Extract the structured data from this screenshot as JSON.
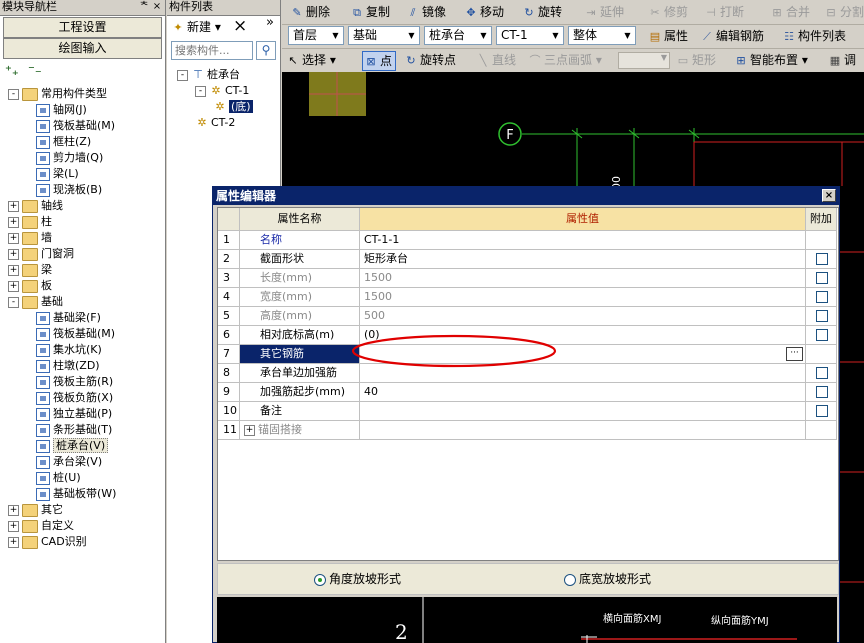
{
  "nav": {
    "title": "模块导航栏",
    "pin": "ᅕ",
    "close": "×",
    "btn_settings": "工程设置",
    "btn_drawing": "绘图输入",
    "tree": [
      {
        "label": "常用构件类型",
        "indent": 0,
        "type": "folder",
        "expand": "-"
      },
      {
        "label": "轴网(J)",
        "indent": 1,
        "type": "comp"
      },
      {
        "label": "筏板基础(M)",
        "indent": 1,
        "type": "comp"
      },
      {
        "label": "框柱(Z)",
        "indent": 1,
        "type": "comp"
      },
      {
        "label": "剪力墙(Q)",
        "indent": 1,
        "type": "comp"
      },
      {
        "label": "梁(L)",
        "indent": 1,
        "type": "comp"
      },
      {
        "label": "现浇板(B)",
        "indent": 1,
        "type": "comp"
      },
      {
        "label": "轴线",
        "indent": 0,
        "type": "folder",
        "expand": "+"
      },
      {
        "label": "柱",
        "indent": 0,
        "type": "folder",
        "expand": "+"
      },
      {
        "label": "墙",
        "indent": 0,
        "type": "folder",
        "expand": "+"
      },
      {
        "label": "门窗洞",
        "indent": 0,
        "type": "folder",
        "expand": "+"
      },
      {
        "label": "梁",
        "indent": 0,
        "type": "folder",
        "expand": "+"
      },
      {
        "label": "板",
        "indent": 0,
        "type": "folder",
        "expand": "+"
      },
      {
        "label": "基础",
        "indent": 0,
        "type": "folder",
        "expand": "-"
      },
      {
        "label": "基础梁(F)",
        "indent": 1,
        "type": "comp"
      },
      {
        "label": "筏板基础(M)",
        "indent": 1,
        "type": "comp"
      },
      {
        "label": "集水坑(K)",
        "indent": 1,
        "type": "comp"
      },
      {
        "label": "柱墩(ZD)",
        "indent": 1,
        "type": "comp"
      },
      {
        "label": "筏板主筋(R)",
        "indent": 1,
        "type": "comp"
      },
      {
        "label": "筏板负筋(X)",
        "indent": 1,
        "type": "comp"
      },
      {
        "label": "独立基础(P)",
        "indent": 1,
        "type": "comp"
      },
      {
        "label": "条形基础(T)",
        "indent": 1,
        "type": "comp"
      },
      {
        "label": "桩承台(V)",
        "indent": 1,
        "type": "comp",
        "selected": true
      },
      {
        "label": "承台梁(V)",
        "indent": 1,
        "type": "comp"
      },
      {
        "label": "桩(U)",
        "indent": 1,
        "type": "comp"
      },
      {
        "label": "基础板带(W)",
        "indent": 1,
        "type": "comp"
      },
      {
        "label": "其它",
        "indent": 0,
        "type": "folder",
        "expand": "+"
      },
      {
        "label": "自定义",
        "indent": 0,
        "type": "folder",
        "expand": "+"
      },
      {
        "label": "CAD识别",
        "indent": 0,
        "type": "folder",
        "expand": "+"
      }
    ]
  },
  "clist": {
    "title": "构件列表",
    "new_label": "新建",
    "delete_icon": "×",
    "more": "»",
    "search_placeholder": "搜索构件...",
    "tree": [
      {
        "label": "桩承台",
        "indent": 0,
        "expand": "-"
      },
      {
        "label": "CT-1",
        "indent": 1,
        "expand": "-"
      },
      {
        "label": "(底)",
        "indent": 2,
        "selected": true
      },
      {
        "label": "CT-2",
        "indent": 1
      }
    ]
  },
  "toolbar": {
    "row1": [
      {
        "label": "删除",
        "icon": "✎",
        "enabled": true
      },
      {
        "label": "复制",
        "icon": "⧉",
        "enabled": true
      },
      {
        "label": "镜像",
        "icon": "⫽",
        "enabled": true
      },
      {
        "label": "移动",
        "icon": "✥",
        "enabled": true
      },
      {
        "label": "旋转",
        "icon": "↻",
        "enabled": true
      },
      {
        "label": "延伸",
        "icon": "⇥",
        "enabled": false
      },
      {
        "label": "修剪",
        "icon": "✂",
        "enabled": false
      },
      {
        "label": "打断",
        "icon": "⊣",
        "enabled": false
      },
      {
        "label": "合并",
        "icon": "⊞",
        "enabled": false
      },
      {
        "label": "分割",
        "icon": "⊟",
        "enabled": false
      }
    ],
    "row2": {
      "floor": "首层",
      "category": "基础",
      "type": "桩承台",
      "name": "CT-1",
      "mode": "整体",
      "buttons": [
        "属性",
        "编辑钢筋",
        "构件列表"
      ]
    },
    "row3": {
      "select": "选择",
      "point": "点",
      "rotate_point": "旋转点",
      "line": "直线",
      "arc": "三点画弧",
      "rect": "矩形",
      "smart": "智能布置",
      "more": "调"
    }
  },
  "canvas": {
    "axis_label": "F",
    "dim_text": "00"
  },
  "dialog": {
    "title": "属性编辑器",
    "close": "×",
    "headers": [
      "属性名称",
      "属性值",
      "附加"
    ],
    "rows": [
      {
        "n": "1",
        "name": "名称",
        "value": "CT-1-1",
        "gray": false,
        "blue": true,
        "check": false
      },
      {
        "n": "2",
        "name": "截面形状",
        "value": "矩形承台",
        "gray": false,
        "blue": false,
        "check": true
      },
      {
        "n": "3",
        "name": "长度(mm)",
        "value": "1500",
        "gray": true,
        "blue": false,
        "check": true
      },
      {
        "n": "4",
        "name": "宽度(mm)",
        "value": "1500",
        "gray": true,
        "blue": false,
        "check": true
      },
      {
        "n": "5",
        "name": "高度(mm)",
        "value": "500",
        "gray": true,
        "blue": false,
        "check": true
      },
      {
        "n": "6",
        "name": "相对底标高(m)",
        "value": "(0)",
        "gray": false,
        "blue": false,
        "check": true
      },
      {
        "n": "7",
        "name": "其它钢筋",
        "value": "",
        "gray": false,
        "blue": false,
        "check": false,
        "selected": true,
        "ellipsis": "···"
      },
      {
        "n": "8",
        "name": "承台单边加强筋",
        "value": "",
        "gray": false,
        "blue": false,
        "check": true
      },
      {
        "n": "9",
        "name": "加强筋起步(mm)",
        "value": "40",
        "gray": false,
        "blue": false,
        "check": true
      },
      {
        "n": "10",
        "name": "备注",
        "value": "",
        "gray": false,
        "blue": false,
        "check": true
      },
      {
        "n": "11",
        "name": "锚固搭接",
        "value": "",
        "gray": true,
        "blue": false,
        "check": false,
        "expand": "+"
      }
    ],
    "radio_angle": "角度放坡形式",
    "radio_width": "底宽放坡形式",
    "preview_num": "2",
    "preview_label1": "横向面筋XMJ",
    "preview_label2": "纵向面筋YMJ"
  }
}
